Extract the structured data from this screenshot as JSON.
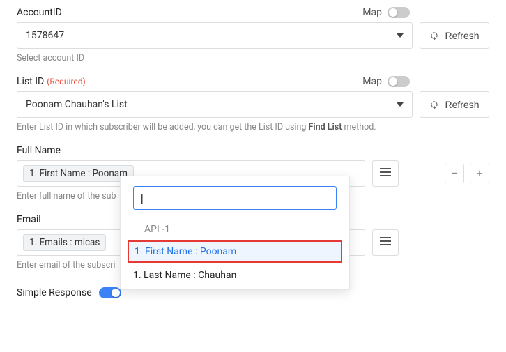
{
  "account": {
    "label": "AccountID",
    "map_label": "Map",
    "value": "1578647",
    "refresh": "Refresh",
    "helper": "Select account ID"
  },
  "list": {
    "label": "List ID",
    "required": "(Required)",
    "map_label": "Map",
    "value": "Poonam Chauhan's List",
    "refresh": "Refresh",
    "helper_prefix": "Enter List ID in which subscriber will be added, you can get the List ID using ",
    "helper_bold": "Find List",
    "helper_suffix": " method."
  },
  "fullname": {
    "label": "Full Name",
    "chip": "1. First Name : Poonam",
    "helper": "Enter full name of the sub"
  },
  "email": {
    "label": "Email",
    "chip": "1. Emails : micas",
    "helper": "Enter email of the subscri"
  },
  "simple_response": {
    "label": "Simple Response"
  },
  "popup": {
    "search_value": "|",
    "group": "API -1",
    "options": [
      "1. First Name : Poonam",
      "1. Last Name : Chauhan"
    ]
  },
  "buttons": {
    "minus": "−",
    "plus": "+"
  }
}
